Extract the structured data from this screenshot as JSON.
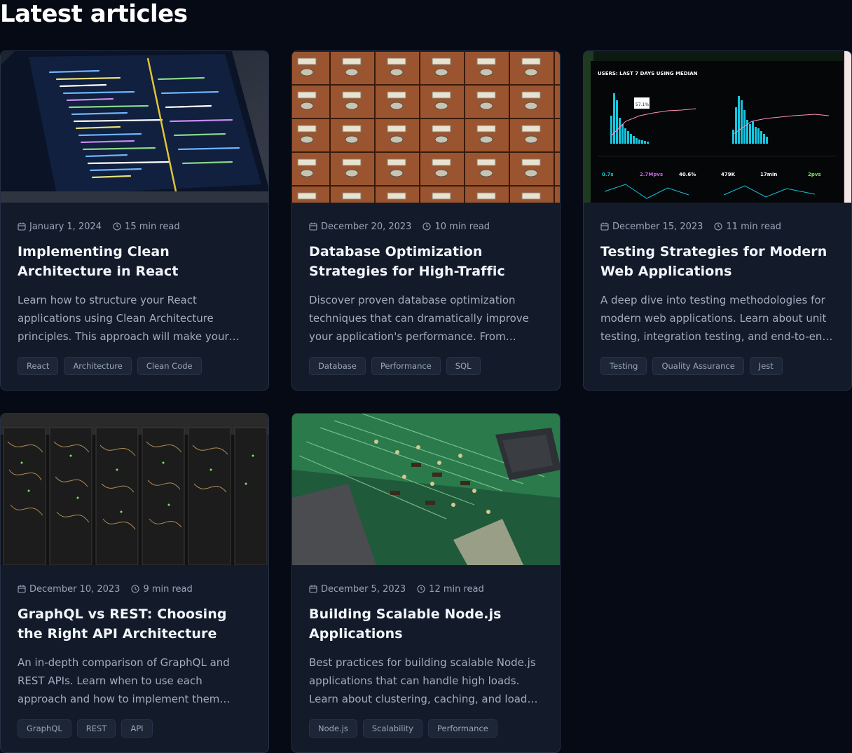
{
  "section": {
    "title": "Latest articles"
  },
  "articles": [
    {
      "image": "code-editor-laptop",
      "date": "January 1, 2024",
      "read_time": "15 min read",
      "title": "Implementing Clean Architecture in React Applications",
      "description": "Learn how to structure your React applications using Clean Architecture principles. This approach will make your code more maintainable, testable, and scalable.",
      "tags": [
        "React",
        "Architecture",
        "Clean Code"
      ]
    },
    {
      "image": "wooden-card-catalog",
      "date": "December 20, 2023",
      "read_time": "10 min read",
      "title": "Database Optimization Strategies for High-Traffic Applications",
      "description": "Discover proven database optimization techniques that can dramatically improve your application's performance. From indexing to query optimization.",
      "tags": [
        "Database",
        "Performance",
        "SQL"
      ]
    },
    {
      "image": "analytics-dashboard",
      "date": "December 15, 2023",
      "read_time": "11 min read",
      "title": "Testing Strategies for Modern Web Applications",
      "description": "A deep dive into testing methodologies for modern web applications. Learn about unit testing, integration testing, and end-to-end testing.",
      "tags": [
        "Testing",
        "Quality Assurance",
        "Jest"
      ],
      "dashboard": {
        "header": "USERS: LAST 7 DAYS USING MEDIAN",
        "stats": [
          "0.7s",
          "2.7Mpvs",
          "40.6%",
          "479K",
          "17min",
          "2pvs"
        ],
        "badge": "57.1%"
      }
    },
    {
      "image": "server-rack-cables",
      "date": "December 10, 2023",
      "read_time": "9 min read",
      "title": "GraphQL vs REST: Choosing the Right API Architecture",
      "description": "An in-depth comparison of GraphQL and REST APIs. Learn when to use each approach and how to implement them effectively in your projects.",
      "tags": [
        "GraphQL",
        "REST",
        "API"
      ]
    },
    {
      "image": "circuit-board",
      "date": "December 5, 2023",
      "read_time": "12 min read",
      "title": "Building Scalable Node.js Applications",
      "description": "Best practices for building scalable Node.js applications that can handle high loads. Learn about clustering, caching, and load balancing.",
      "tags": [
        "Node.js",
        "Scalability",
        "Performance"
      ]
    }
  ],
  "colors": {
    "background": "#050a14",
    "card": "#131b2a",
    "border": "#253046",
    "tag_bg": "#1d2636",
    "muted_text": "#a3adbd"
  }
}
